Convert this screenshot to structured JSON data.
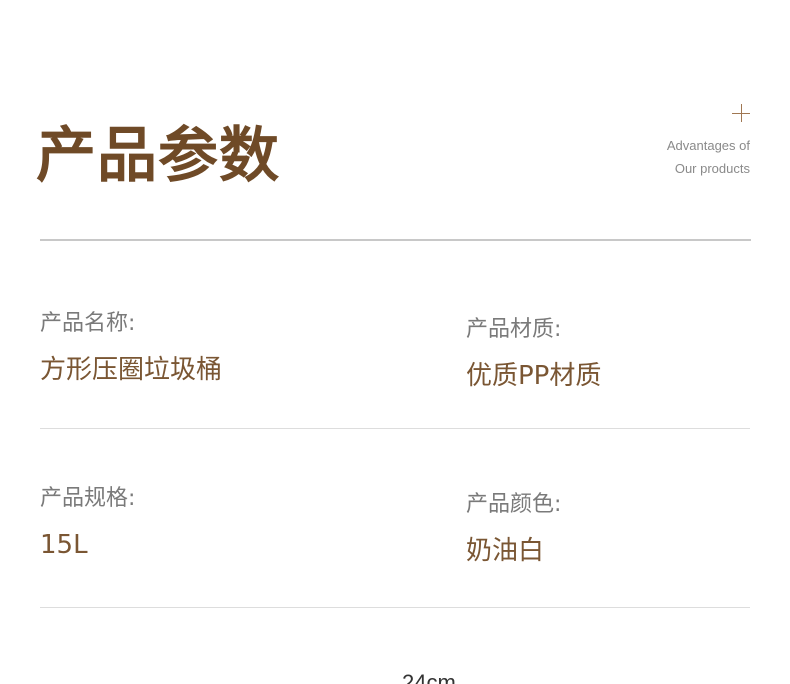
{
  "header": {
    "title": "产品参数",
    "tagline_line1": "Advantages of",
    "tagline_line2": "Our products",
    "mark_icon": "crosshair-icon"
  },
  "params": [
    {
      "label": "产品名称:",
      "value": "方形压圈垃圾桶"
    },
    {
      "label": "产品材质:",
      "value": "优质PP材质"
    },
    {
      "label": "产品规格:",
      "value": "15L"
    },
    {
      "label": "产品颜色:",
      "value": "奶油白"
    }
  ],
  "dimension": {
    "label": "24cm"
  },
  "colors": {
    "title": "#6f4a27",
    "value": "#7a5633",
    "label": "#7a7a7a",
    "accent": "#a07752"
  }
}
